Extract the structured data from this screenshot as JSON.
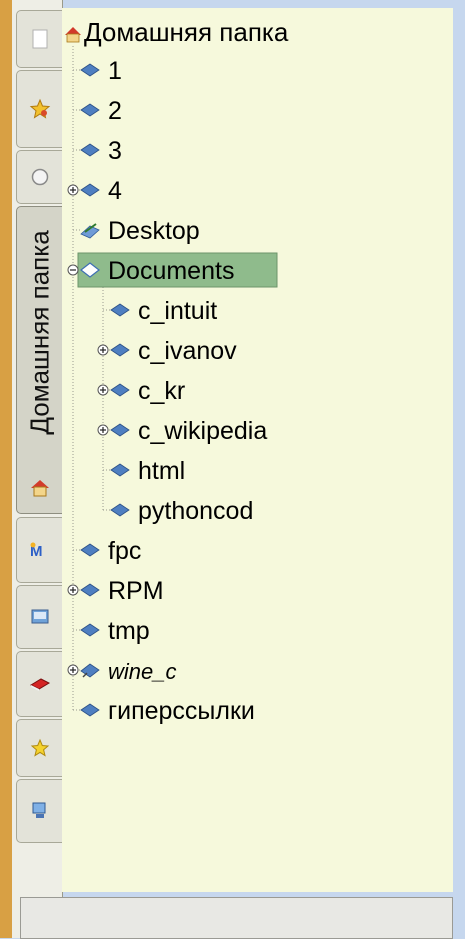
{
  "sidebar": {
    "active_tab_label": "Домашняя папка",
    "tabs": [
      {
        "icon": "document-icon"
      },
      {
        "icon": "favorites-star-icon"
      },
      {
        "icon": "history-clock-icon"
      },
      {
        "icon": "home-folder-icon"
      },
      {
        "icon": "media-icon"
      },
      {
        "icon": "removable-drive-icon"
      },
      {
        "icon": "red-book-icon"
      },
      {
        "icon": "star-icon"
      },
      {
        "icon": "network-computer-icon"
      }
    ]
  },
  "tree": {
    "root": "Домашняя папка",
    "items": [
      {
        "label": "1",
        "depth": 1,
        "expander": false,
        "italic": false,
        "selected": false
      },
      {
        "label": "2",
        "depth": 1,
        "expander": false,
        "italic": false,
        "selected": false
      },
      {
        "label": "3",
        "depth": 1,
        "expander": false,
        "italic": false,
        "selected": false
      },
      {
        "label": "4",
        "depth": 1,
        "expander": "plus",
        "italic": false,
        "selected": false
      },
      {
        "label": "Desktop",
        "depth": 1,
        "expander": false,
        "italic": false,
        "selected": false
      },
      {
        "label": "Documents",
        "depth": 1,
        "expander": "minus",
        "italic": false,
        "selected": true
      },
      {
        "label": "c_intuit",
        "depth": 2,
        "expander": false,
        "italic": false,
        "selected": false
      },
      {
        "label": "c_ivanov",
        "depth": 2,
        "expander": "plus",
        "italic": false,
        "selected": false
      },
      {
        "label": "c_kr",
        "depth": 2,
        "expander": "plus",
        "italic": false,
        "selected": false
      },
      {
        "label": "c_wikipedia",
        "depth": 2,
        "expander": "plus",
        "italic": false,
        "selected": false
      },
      {
        "label": "html",
        "depth": 2,
        "expander": false,
        "italic": false,
        "selected": false
      },
      {
        "label": "pythoncod",
        "depth": 2,
        "expander": false,
        "italic": false,
        "selected": false
      },
      {
        "label": "fpc",
        "depth": 1,
        "expander": false,
        "italic": false,
        "selected": false
      },
      {
        "label": "RPM",
        "depth": 1,
        "expander": "plus",
        "italic": false,
        "selected": false
      },
      {
        "label": "tmp",
        "depth": 1,
        "expander": false,
        "italic": false,
        "selected": false
      },
      {
        "label": "wine_c",
        "depth": 1,
        "expander": "plus",
        "italic": true,
        "selected": false
      },
      {
        "label": "гиперссылки",
        "depth": 1,
        "expander": false,
        "italic": false,
        "selected": false
      }
    ]
  },
  "colors": {
    "panel_bg": "#f6f9dc",
    "selection_bg": "#8fbb8c",
    "folder_blue": "#4f7fc0",
    "desktop_bg": "#c6d7ee"
  }
}
